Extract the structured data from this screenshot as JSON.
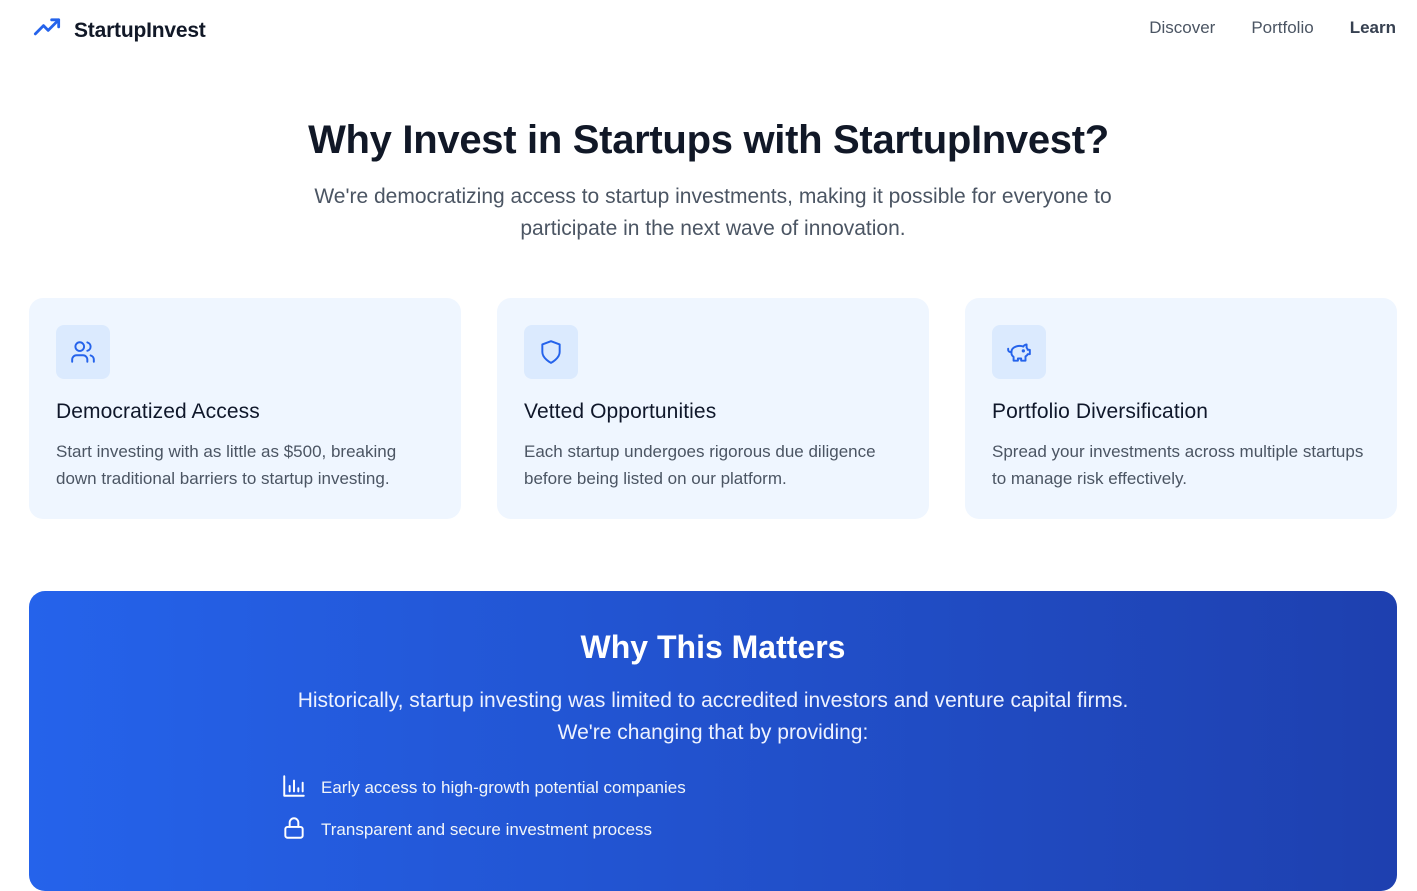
{
  "brand": {
    "name": "StartupInvest",
    "icon": "trending-up-icon"
  },
  "nav": {
    "items": [
      {
        "label": "Discover",
        "active": false
      },
      {
        "label": "Portfolio",
        "active": false
      },
      {
        "label": "Learn",
        "active": true
      }
    ]
  },
  "hero": {
    "title": "Why Invest in Startups with StartupInvest?",
    "subtitle": "We're democratizing access to startup investments, making it possible for everyone to participate in the next wave of innovation."
  },
  "features": [
    {
      "icon": "users-icon",
      "title": "Democratized Access",
      "text": "Start investing with as little as $500, breaking down traditional barriers to startup investing."
    },
    {
      "icon": "shield-icon",
      "title": "Vetted Opportunities",
      "text": "Each startup undergoes rigorous due diligence before being listed on our platform."
    },
    {
      "icon": "piggy-bank-icon",
      "title": "Portfolio Diversification",
      "text": "Spread your investments across multiple startups to manage risk effectively."
    }
  ],
  "matters": {
    "title": "Why This Matters",
    "subtitle": "Historically, startup investing was limited to accredited investors and venture capital firms. We're changing that by providing:",
    "benefits": [
      {
        "icon": "bar-chart-icon",
        "text": "Early access to high-growth potential companies"
      },
      {
        "icon": "lock-icon",
        "text": "Transparent and secure investment process"
      }
    ]
  },
  "colors": {
    "accent": "#2563eb",
    "accent_dark": "#1e40af",
    "card_bg": "#eff6ff",
    "icon_bg": "#dbeafe",
    "heading": "#111827",
    "body_text": "#4b5563"
  }
}
